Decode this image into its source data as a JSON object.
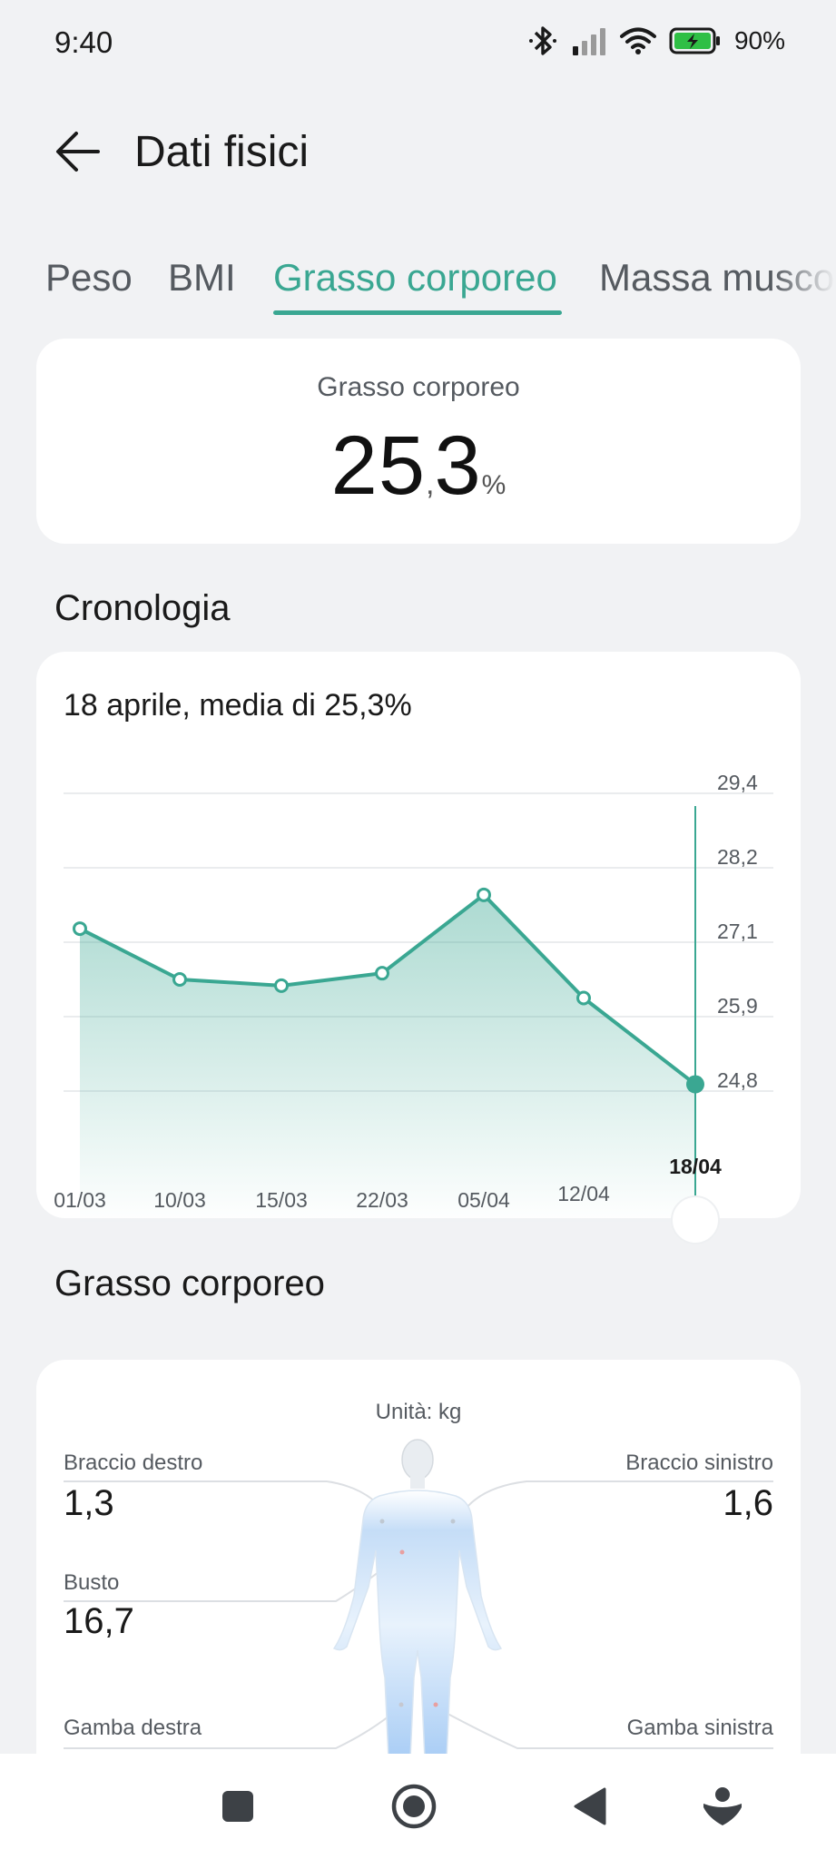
{
  "status_bar": {
    "time": "9:40",
    "battery": "90%"
  },
  "header": {
    "title": "Dati fisici"
  },
  "tabs": [
    {
      "label": "Peso"
    },
    {
      "label": "BMI"
    },
    {
      "label": "Grasso corporeo"
    },
    {
      "label": "Massa musco"
    }
  ],
  "active_tab": "Grasso corporeo",
  "summary": {
    "label": "Grasso corporeo",
    "value_int": "25",
    "value_dec": ",3",
    "unit": "%"
  },
  "history": {
    "title": "Cronologia",
    "summary_text": "18 aprile, media di 25,3%"
  },
  "chart_data": {
    "type": "area",
    "x": [
      "01/03",
      "10/03",
      "15/03",
      "22/03",
      "05/04",
      "12/04",
      "18/04"
    ],
    "values": [
      27.3,
      26.5,
      26.4,
      26.6,
      27.8,
      26.2,
      24.9
    ],
    "y_ticks": [
      "29,4",
      "28,2",
      "27,1",
      "25,9",
      "24,8"
    ],
    "ylim": [
      23.0,
      29.4
    ],
    "selected_index": 6,
    "grid": true,
    "color": "#3aa792"
  },
  "body_fat": {
    "title": "Grasso corporeo",
    "unit_label": "Unità:  kg",
    "right_arm": {
      "label": "Braccio destro",
      "value": "1,3"
    },
    "left_arm": {
      "label": "Braccio sinistro",
      "value": "1,6"
    },
    "torso": {
      "label": "Busto",
      "value": "16,7"
    },
    "right_leg": {
      "label": "Gamba destra"
    },
    "left_leg": {
      "label": "Gamba sinistra"
    }
  },
  "nav_bar": {
    "icons": [
      "square-icon",
      "home-circle-icon",
      "back-triangle-icon",
      "assistant-icon"
    ]
  }
}
